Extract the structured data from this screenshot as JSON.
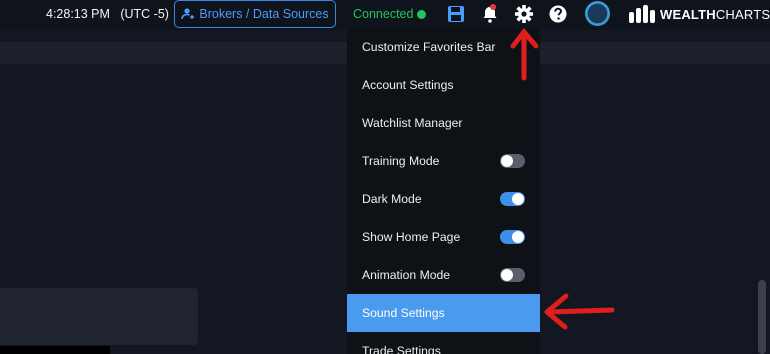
{
  "topbar": {
    "time": "4:28:13 PM",
    "timezone": "(UTC -5)",
    "brokers_label": "Brokers / Data Sources",
    "connection_status": "Connected",
    "logo_bold": "WEALTH",
    "logo_light": "CHARTS"
  },
  "icons": [
    "person-link-icon",
    "save-icon",
    "bell-icon",
    "gear-icon",
    "help-icon"
  ],
  "colors": {
    "accent": "#4a9af0",
    "connected": "#22c55e",
    "annotation": "#e01e1e"
  },
  "settings_menu": {
    "items": [
      {
        "label": "Customize Favorites Bar"
      },
      {
        "label": "Account Settings"
      },
      {
        "label": "Watchlist Manager"
      },
      {
        "label": "Training Mode",
        "toggle": false
      },
      {
        "label": "Dark Mode",
        "toggle": true
      },
      {
        "label": "Show Home Page",
        "toggle": true
      },
      {
        "label": "Animation Mode",
        "toggle": false
      },
      {
        "label": "Sound Settings",
        "highlighted": true
      },
      {
        "label": "Trade Settings"
      }
    ]
  }
}
